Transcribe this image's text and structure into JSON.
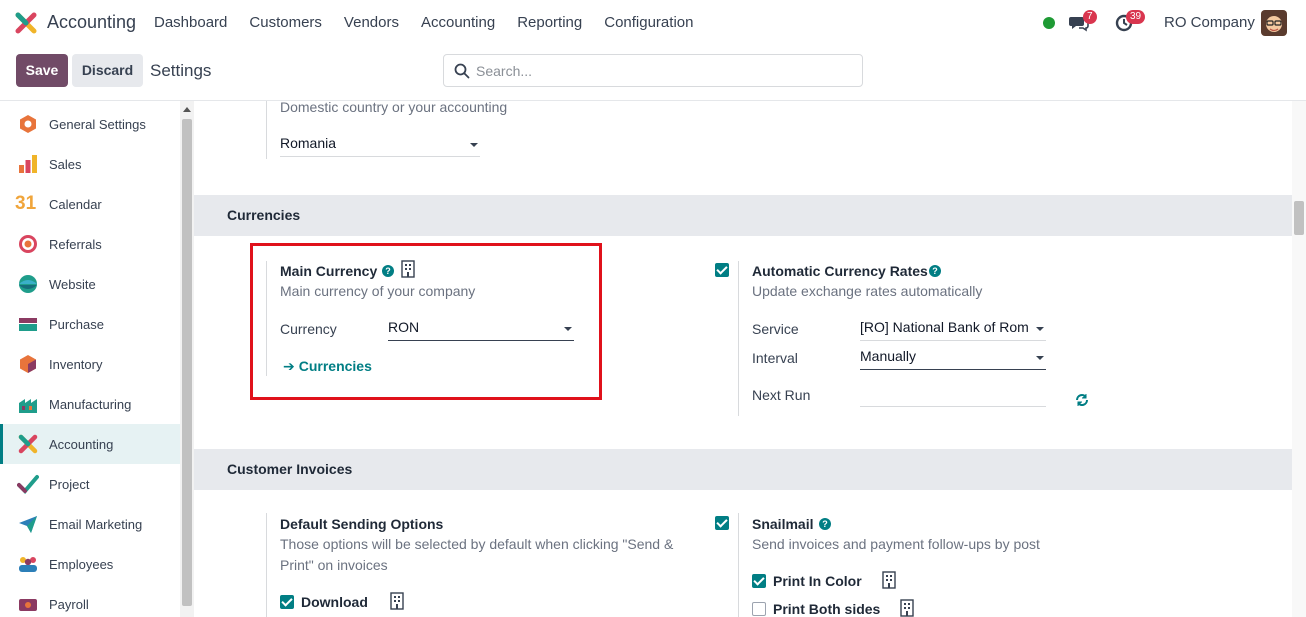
{
  "navbar": {
    "app_name": "Accounting",
    "menu": [
      "Dashboard",
      "Customers",
      "Vendors",
      "Accounting",
      "Reporting",
      "Configuration"
    ],
    "messages_count": "7",
    "activities_count": "39",
    "company": "RO Company"
  },
  "control": {
    "save_label": "Save",
    "discard_label": "Discard",
    "title": "Settings",
    "search_placeholder": "Search..."
  },
  "sidebar": {
    "items": [
      {
        "label": "General Settings",
        "icon": "general-settings-icon"
      },
      {
        "label": "Sales",
        "icon": "sales-icon"
      },
      {
        "label": "Calendar",
        "icon": "calendar-icon"
      },
      {
        "label": "Referrals",
        "icon": "referrals-icon"
      },
      {
        "label": "Website",
        "icon": "website-icon"
      },
      {
        "label": "Purchase",
        "icon": "purchase-icon"
      },
      {
        "label": "Inventory",
        "icon": "inventory-icon"
      },
      {
        "label": "Manufacturing",
        "icon": "manufacturing-icon"
      },
      {
        "label": "Accounting",
        "icon": "accounting-icon",
        "active": true
      },
      {
        "label": "Project",
        "icon": "project-icon"
      },
      {
        "label": "Email Marketing",
        "icon": "email-marketing-icon"
      },
      {
        "label": "Employees",
        "icon": "employees-icon"
      },
      {
        "label": "Payroll",
        "icon": "payroll-icon"
      }
    ],
    "calendar_day": "31"
  },
  "fiscal": {
    "description": "Domestic country or your accounting",
    "country": "Romania"
  },
  "currencies": {
    "section_title": "Currencies",
    "main_currency": {
      "title": "Main Currency",
      "description": "Main currency of your company",
      "currency_label": "Currency",
      "currency_value": "RON",
      "link_label": "Currencies"
    },
    "auto_rates": {
      "title": "Automatic Currency Rates",
      "description": "Update exchange rates automatically",
      "service_label": "Service",
      "service_value": "[RO] National Bank of Rom",
      "interval_label": "Interval",
      "interval_value": "Manually",
      "next_run_label": "Next Run",
      "next_run_value": ""
    }
  },
  "customer_invoices": {
    "section_title": "Customer Invoices",
    "default_sending": {
      "title": "Default Sending Options",
      "description_line1": "Those options will be selected by default when clicking \"Send &",
      "description_line2": "Print\" on invoices",
      "download_label": "Download"
    },
    "snailmail": {
      "title": "Snailmail",
      "description": "Send invoices and payment follow-ups by post",
      "print_color_label": "Print In Color",
      "print_both_sides_label": "Print Both sides"
    }
  },
  "colors": {
    "brand": "#714b67",
    "accent": "#017e84",
    "highlight": "#e0111b"
  }
}
